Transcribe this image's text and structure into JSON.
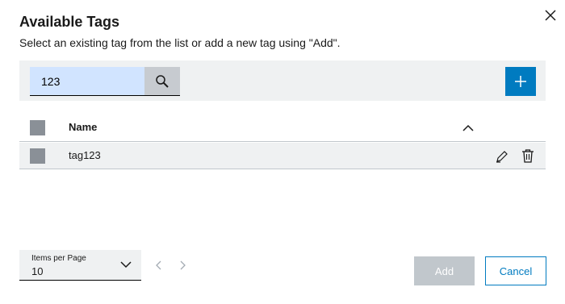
{
  "dialog": {
    "title": "Available Tags",
    "subtitle": "Select an existing tag from the list or add a new tag using \"Add\"."
  },
  "icons": {
    "close": "close-icon",
    "search": "search-icon",
    "add": "plus-icon",
    "sort": "chevron-up-icon",
    "edit": "pencil-icon",
    "delete": "trash-icon",
    "dropdown": "chevron-down-icon",
    "prev": "chevron-left-icon",
    "next": "chevron-right-icon"
  },
  "search": {
    "value": "123",
    "placeholder": ""
  },
  "table": {
    "columns": [
      {
        "label": "Name",
        "sort": "ascending"
      }
    ],
    "rows": [
      {
        "name": "tag123"
      }
    ]
  },
  "pagination": {
    "label": "Items per Page",
    "value": "10"
  },
  "footer": {
    "add_label": "Add",
    "cancel_label": "Cancel"
  },
  "colors": {
    "primary": "#007bc0",
    "search_bg": "#d1e4ff",
    "toolbar_bg": "#eff1f2",
    "checkbox": "#8a9097",
    "disabled_button": "#c1c7cc"
  }
}
